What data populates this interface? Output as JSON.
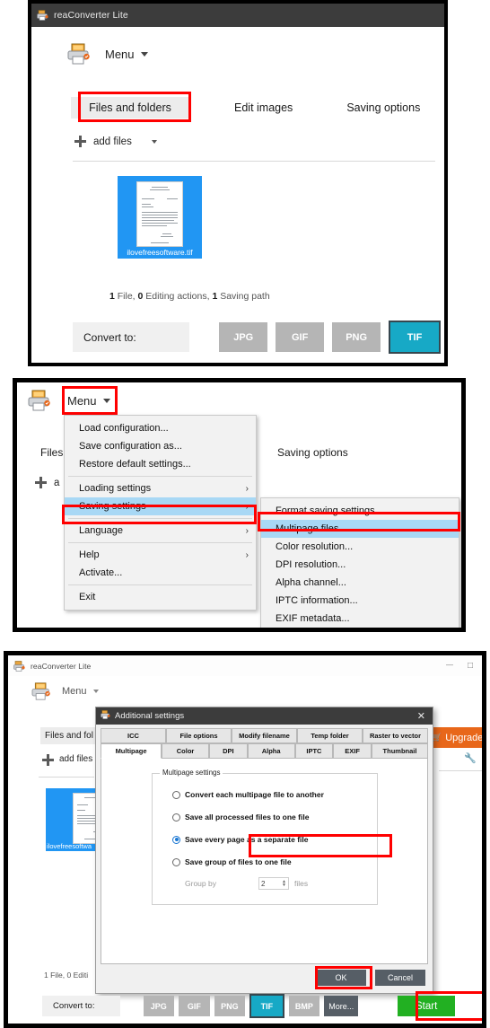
{
  "app": {
    "title": "reaConverter Lite",
    "menu_label": "Menu",
    "printer_icon": "printer-icon",
    "caret_icon": "caret-down-icon"
  },
  "panel1": {
    "tabs": [
      {
        "label": "Files and folders",
        "active": true
      },
      {
        "label": "Edit images",
        "active": false
      },
      {
        "label": "Saving options",
        "active": false
      }
    ],
    "add_files": "add files",
    "file": {
      "name": "ilovefreesoftware.tif"
    },
    "status": {
      "files": "1",
      "files_label": "File,",
      "actions": "0",
      "actions_label": "Editing actions,",
      "paths": "1",
      "paths_label": "Saving path"
    },
    "convert_label": "Convert to:",
    "formats": [
      {
        "label": "JPG",
        "selected": false
      },
      {
        "label": "GIF",
        "selected": false
      },
      {
        "label": "PNG",
        "selected": false
      },
      {
        "label": "TIF",
        "selected": true
      }
    ]
  },
  "panel2": {
    "menu_label": "Menu",
    "tab_files": "Files",
    "tab_saving_options": "Saving options",
    "add_label": "a",
    "menu_items": [
      {
        "label": "Load configuration...",
        "submenu": false,
        "selected": false
      },
      {
        "label": "Save configuration as...",
        "submenu": false,
        "selected": false
      },
      {
        "label": "Restore default settings...",
        "submenu": false,
        "selected": false
      },
      {
        "label": "Loading settings",
        "submenu": true,
        "selected": false
      },
      {
        "label": "Saving settings",
        "submenu": true,
        "selected": true
      },
      {
        "label": "Language",
        "submenu": true,
        "selected": false
      },
      {
        "label": "Help",
        "submenu": true,
        "selected": false
      },
      {
        "label": "Activate...",
        "submenu": false,
        "selected": false
      },
      {
        "label": "Exit",
        "submenu": false,
        "selected": false
      }
    ],
    "submenu_items": [
      {
        "label": "Format saving settings...",
        "selected": false
      },
      {
        "label": "Multipage files...",
        "selected": true
      },
      {
        "label": "Color resolution...",
        "selected": false
      },
      {
        "label": "DPI resolution...",
        "selected": false
      },
      {
        "label": "Alpha channel...",
        "selected": false
      },
      {
        "label": "IPTC information...",
        "selected": false
      },
      {
        "label": "EXIF metadata...",
        "selected": false
      }
    ],
    "submenu_arrow": "›"
  },
  "panel3": {
    "title": "reaConverter Lite",
    "menu_label": "Menu",
    "minimize_glyph": "—",
    "maximize_glyph": "□",
    "tab_files_and_folders": "Files and fol",
    "add_files": "add files",
    "upgrade_label": "Upgrade",
    "cart_icon": "cart-icon",
    "wrench_icon": "wrench-icon",
    "file": {
      "name": "ilovefreesoftwa"
    },
    "status": "1 File, 0 Editi",
    "convert_label": "Convert to:",
    "formats": [
      {
        "label": "JPG",
        "selected": false,
        "style": "normal"
      },
      {
        "label": "GIF",
        "selected": false,
        "style": "normal"
      },
      {
        "label": "PNG",
        "selected": false,
        "style": "normal"
      },
      {
        "label": "TIF",
        "selected": true,
        "style": "normal"
      },
      {
        "label": "BMP",
        "selected": false,
        "style": "normal"
      },
      {
        "label": "More...",
        "selected": false,
        "style": "more"
      }
    ],
    "start_label": "Start",
    "dialog": {
      "title": "Additional settings",
      "close_glyph": "✕",
      "tabs_row1": [
        "ICC",
        "File options",
        "Modify filename",
        "Temp folder",
        "Raster to vector"
      ],
      "tabs_row2": [
        "Multipage",
        "Color",
        "DPI",
        "Alpha",
        "IPTC",
        "EXIF",
        "Thumbnail"
      ],
      "active_tab": "Multipage",
      "group_title": "Multipage settings",
      "options": [
        {
          "label": "Convert each multipage file to another",
          "checked": false
        },
        {
          "label": "Save all processed files to one file",
          "checked": false
        },
        {
          "label": "Save every page as a separate file",
          "checked": true
        },
        {
          "label": "Save group of files to one file",
          "checked": false
        }
      ],
      "group_by_label": "Group by",
      "group_by_value": "2",
      "group_by_suffix": "files",
      "ok_label": "OK",
      "cancel_label": "Cancel"
    }
  },
  "colors": {
    "titlebar": "#3c3c3c",
    "accent_tif": "#17a9c6",
    "upgrade_orange": "#e8671a",
    "start_green": "#22b022",
    "highlight_red": "#ff0000",
    "highlight_green": "#11aa11",
    "menu_selected": "#a8d8f5",
    "thumb_select_blue": "#2196f3"
  }
}
